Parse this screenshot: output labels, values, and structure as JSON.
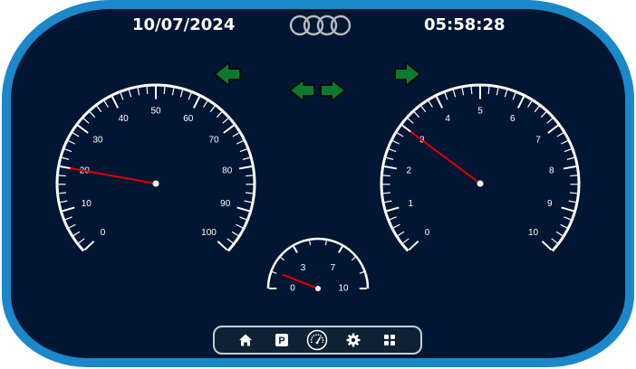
{
  "header": {
    "date": "10/07/2024",
    "time": "05:58:28",
    "logo": "four-rings-logo"
  },
  "indicators": {
    "left_turn": {
      "icon": "arrow-left-icon",
      "color": "#0c7a2e"
    },
    "hazard": {
      "icons": [
        "arrow-left-icon",
        "arrow-right-icon"
      ],
      "color": "#0c7a2e"
    },
    "right_turn": {
      "icon": "arrow-right-icon",
      "color": "#0c7a2e"
    }
  },
  "gauges": {
    "speed": {
      "labels": [
        "0",
        "10",
        "20",
        "30",
        "40",
        "50",
        "60",
        "70",
        "80",
        "90",
        "100"
      ],
      "min": 0,
      "max": 100,
      "value": 20
    },
    "rpm": {
      "labels": [
        "0",
        "1",
        "2",
        "3",
        "4",
        "5",
        "6",
        "7",
        "8",
        "9",
        "10"
      ],
      "min": 0,
      "max": 10,
      "value": 3
    },
    "aux": {
      "labels": [
        "0",
        "3",
        "7",
        "10"
      ],
      "min": 0,
      "max": 10,
      "value": 1.2
    }
  },
  "colors": {
    "frame": "#1a88c9",
    "background": "#001633",
    "needle": "#e00000",
    "indicator": "#0c7a2e"
  },
  "navbar": {
    "items": [
      {
        "name": "home-icon"
      },
      {
        "name": "parking-icon",
        "label": "P"
      },
      {
        "name": "speedometer-icon"
      },
      {
        "name": "gear-icon"
      },
      {
        "name": "grid-icon"
      }
    ]
  }
}
